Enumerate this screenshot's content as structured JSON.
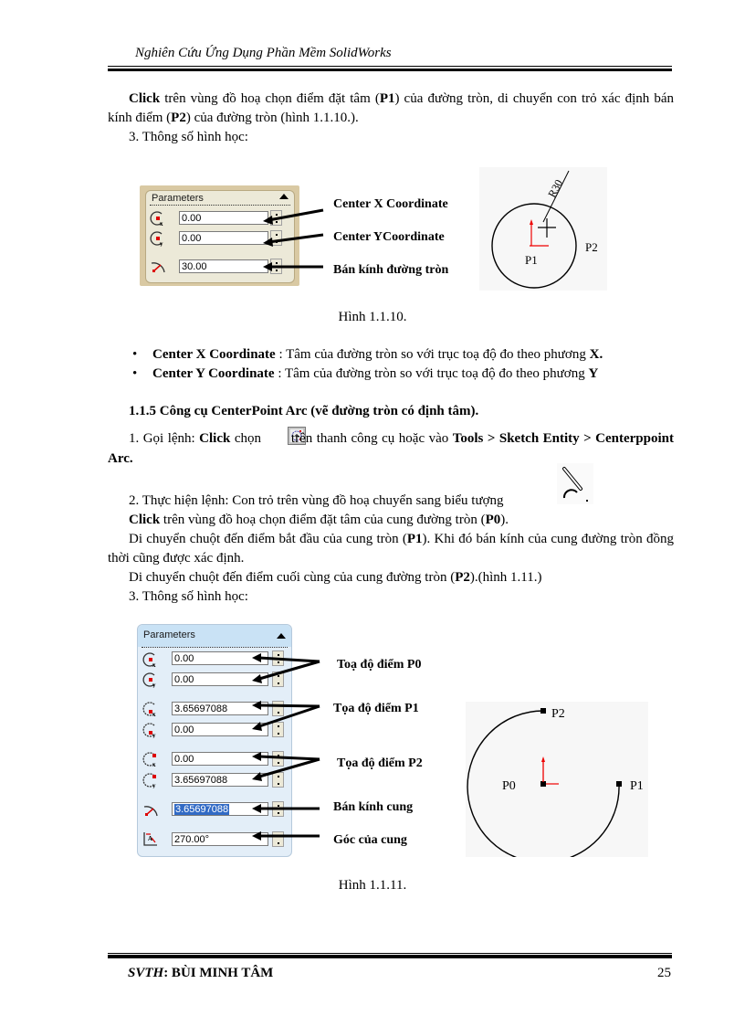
{
  "header": {
    "title": "Nghiên Cứu Ứng Dụng Phần Mềm SolidWorks"
  },
  "section_circle": {
    "para1_bold": "Click",
    "para1_a": " trên vùng đồ hoạ chọn điểm đặt tâm (",
    "para1_p1": "P1",
    "para1_b": ") của đường tròn, di chuyển con trỏ xác định bán kính điểm (",
    "para1_p2": "P2",
    "para1_c": ") của đường tròn (hình 1.1.10.).",
    "geom_heading": "3. Thông số hình học:",
    "panel": {
      "title": "Parameters",
      "fields": [
        {
          "icon": "center-x-icon",
          "value": "0.00"
        },
        {
          "icon": "center-y-icon",
          "value": "0.00"
        },
        {
          "icon": "radius-icon",
          "value": "30.00"
        }
      ]
    },
    "labels": [
      "Center X Coordinate",
      "Center YCoordinate",
      "Bán kính đường tròn"
    ],
    "sketch": {
      "dimension": "R30",
      "center_label": "P1",
      "edge_label": "P2"
    },
    "caption": "Hình 1.1.10.",
    "bullets": [
      {
        "bold": "Center X Coordinate",
        "text": " : Tâm của đường tròn so với trục toạ độ đo theo phương ",
        "axis": "X."
      },
      {
        "bold": "Center Y Coordinate",
        "text": " : Tâm của đường tròn so với trục toạ độ đo theo phương ",
        "axis": "Y"
      }
    ]
  },
  "section_arc": {
    "heading": "1.1.5  Công cụ CenterPoint Arc (vẽ đường tròn có định tâm).",
    "step1_a": "1. Gọi lệnh: ",
    "step1_click": "Click",
    "step1_b": " chọn ",
    "step1_c": " trên thanh công cụ hoặc vào ",
    "step1_menu": "Tools > Sketch Entity > Centerppoint Arc.",
    "step2": "2. Thực hiện lệnh: Con trỏ trên vùng đồ hoạ chuyển sang biểu tượng",
    "step2_click": "Click",
    "step2_b": " trên vùng đồ hoạ chọn điểm đặt tâm của cung đường tròn (",
    "step2_p0": "P0",
    "step2_c": ").",
    "step3_a": "Di chuyển chuột đến điểm bắt đầu của cung tròn (",
    "step3_p1": "P1",
    "step3_b": "). Khi đó bán kính của cung đường tròn đồng thời cũng được xác định.",
    "step4_a": "Di chuyển  chuột đến điểm cuối cùng của cung đường tròn (",
    "step4_p2": "P2",
    "step4_b": ").(hình 1.11.)",
    "geom_heading": "3. Thông số hình học:",
    "panel": {
      "title": "Parameters",
      "fields": [
        {
          "icon": "center-x-icon",
          "value": "0.00"
        },
        {
          "icon": "center-y-icon",
          "value": "0.00"
        },
        {
          "icon": "start-x-icon",
          "value": "3.65697088"
        },
        {
          "icon": "start-y-icon",
          "value": "0.00"
        },
        {
          "icon": "end-x-icon",
          "value": "0.00"
        },
        {
          "icon": "end-y-icon",
          "value": "3.65697088"
        },
        {
          "icon": "radius-icon",
          "value": "3.65697088",
          "selected": true
        },
        {
          "icon": "angle-icon",
          "value": "270.00°"
        }
      ]
    },
    "labels": [
      "Toạ độ điểm P0",
      "Tọa độ điểm P1",
      "Tọa độ điểm P2",
      "Bán kính cung",
      "Góc của cung"
    ],
    "sketch": {
      "center_label": "P0",
      "start_label": "P1",
      "end_label": "P2"
    },
    "caption": "Hình 1.1.11."
  },
  "footer": {
    "svth_label": "SVTH",
    "author": ":  BÙI MINH TÂM",
    "page_number": "25"
  }
}
